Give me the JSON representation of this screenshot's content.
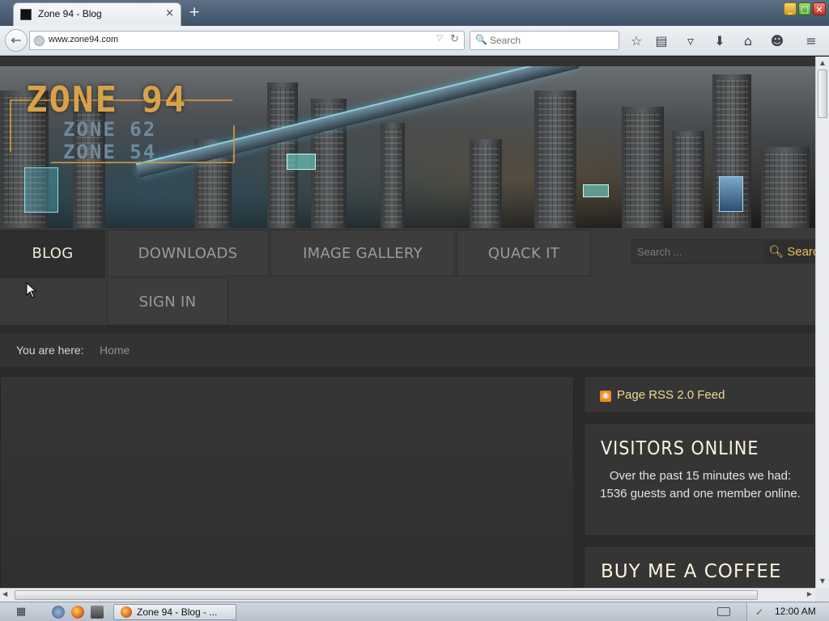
{
  "browser": {
    "tab_title": "Zone 94 - Blog",
    "tab_close": "×",
    "new_tab": "+",
    "url": "www.zone94.com",
    "search_placeholder": "Search",
    "toolbar_icons": [
      "bookmark-star-icon",
      "reading-list-icon",
      "pocket-icon",
      "download-icon",
      "home-icon",
      "chat-icon",
      "menu-icon"
    ]
  },
  "site": {
    "logo": {
      "main": "ZONE 94",
      "sub1": "ZONE 62",
      "sub2": "ZONE 54"
    },
    "menu": {
      "items": [
        {
          "label": "BLOG",
          "active": true
        },
        {
          "label": "DOWNLOADS"
        },
        {
          "label": "IMAGE GALLERY"
        },
        {
          "label": "QUACK IT"
        },
        {
          "label": "SIGN IN"
        }
      ],
      "search_placeholder": "Search ...",
      "search_button": "Search"
    },
    "breadcrumb": {
      "label": "You are here:",
      "home": "Home"
    },
    "sidebar": {
      "rss_link": "Page RSS 2.0 Feed",
      "visitors_title": "VISITORS ONLINE",
      "visitors_text": "Over the past 15 minutes we had: 1536 guests and one member online.",
      "coffee_title": "BUY ME A COFFEE"
    }
  },
  "taskbar": {
    "task_label": "Zone 94 - Blog - ...",
    "clock": "12:00 AM"
  },
  "colors": {
    "accent_gold": "#e5c262",
    "menu_text": "#9a9a9a",
    "panel_bg": "#353535"
  }
}
